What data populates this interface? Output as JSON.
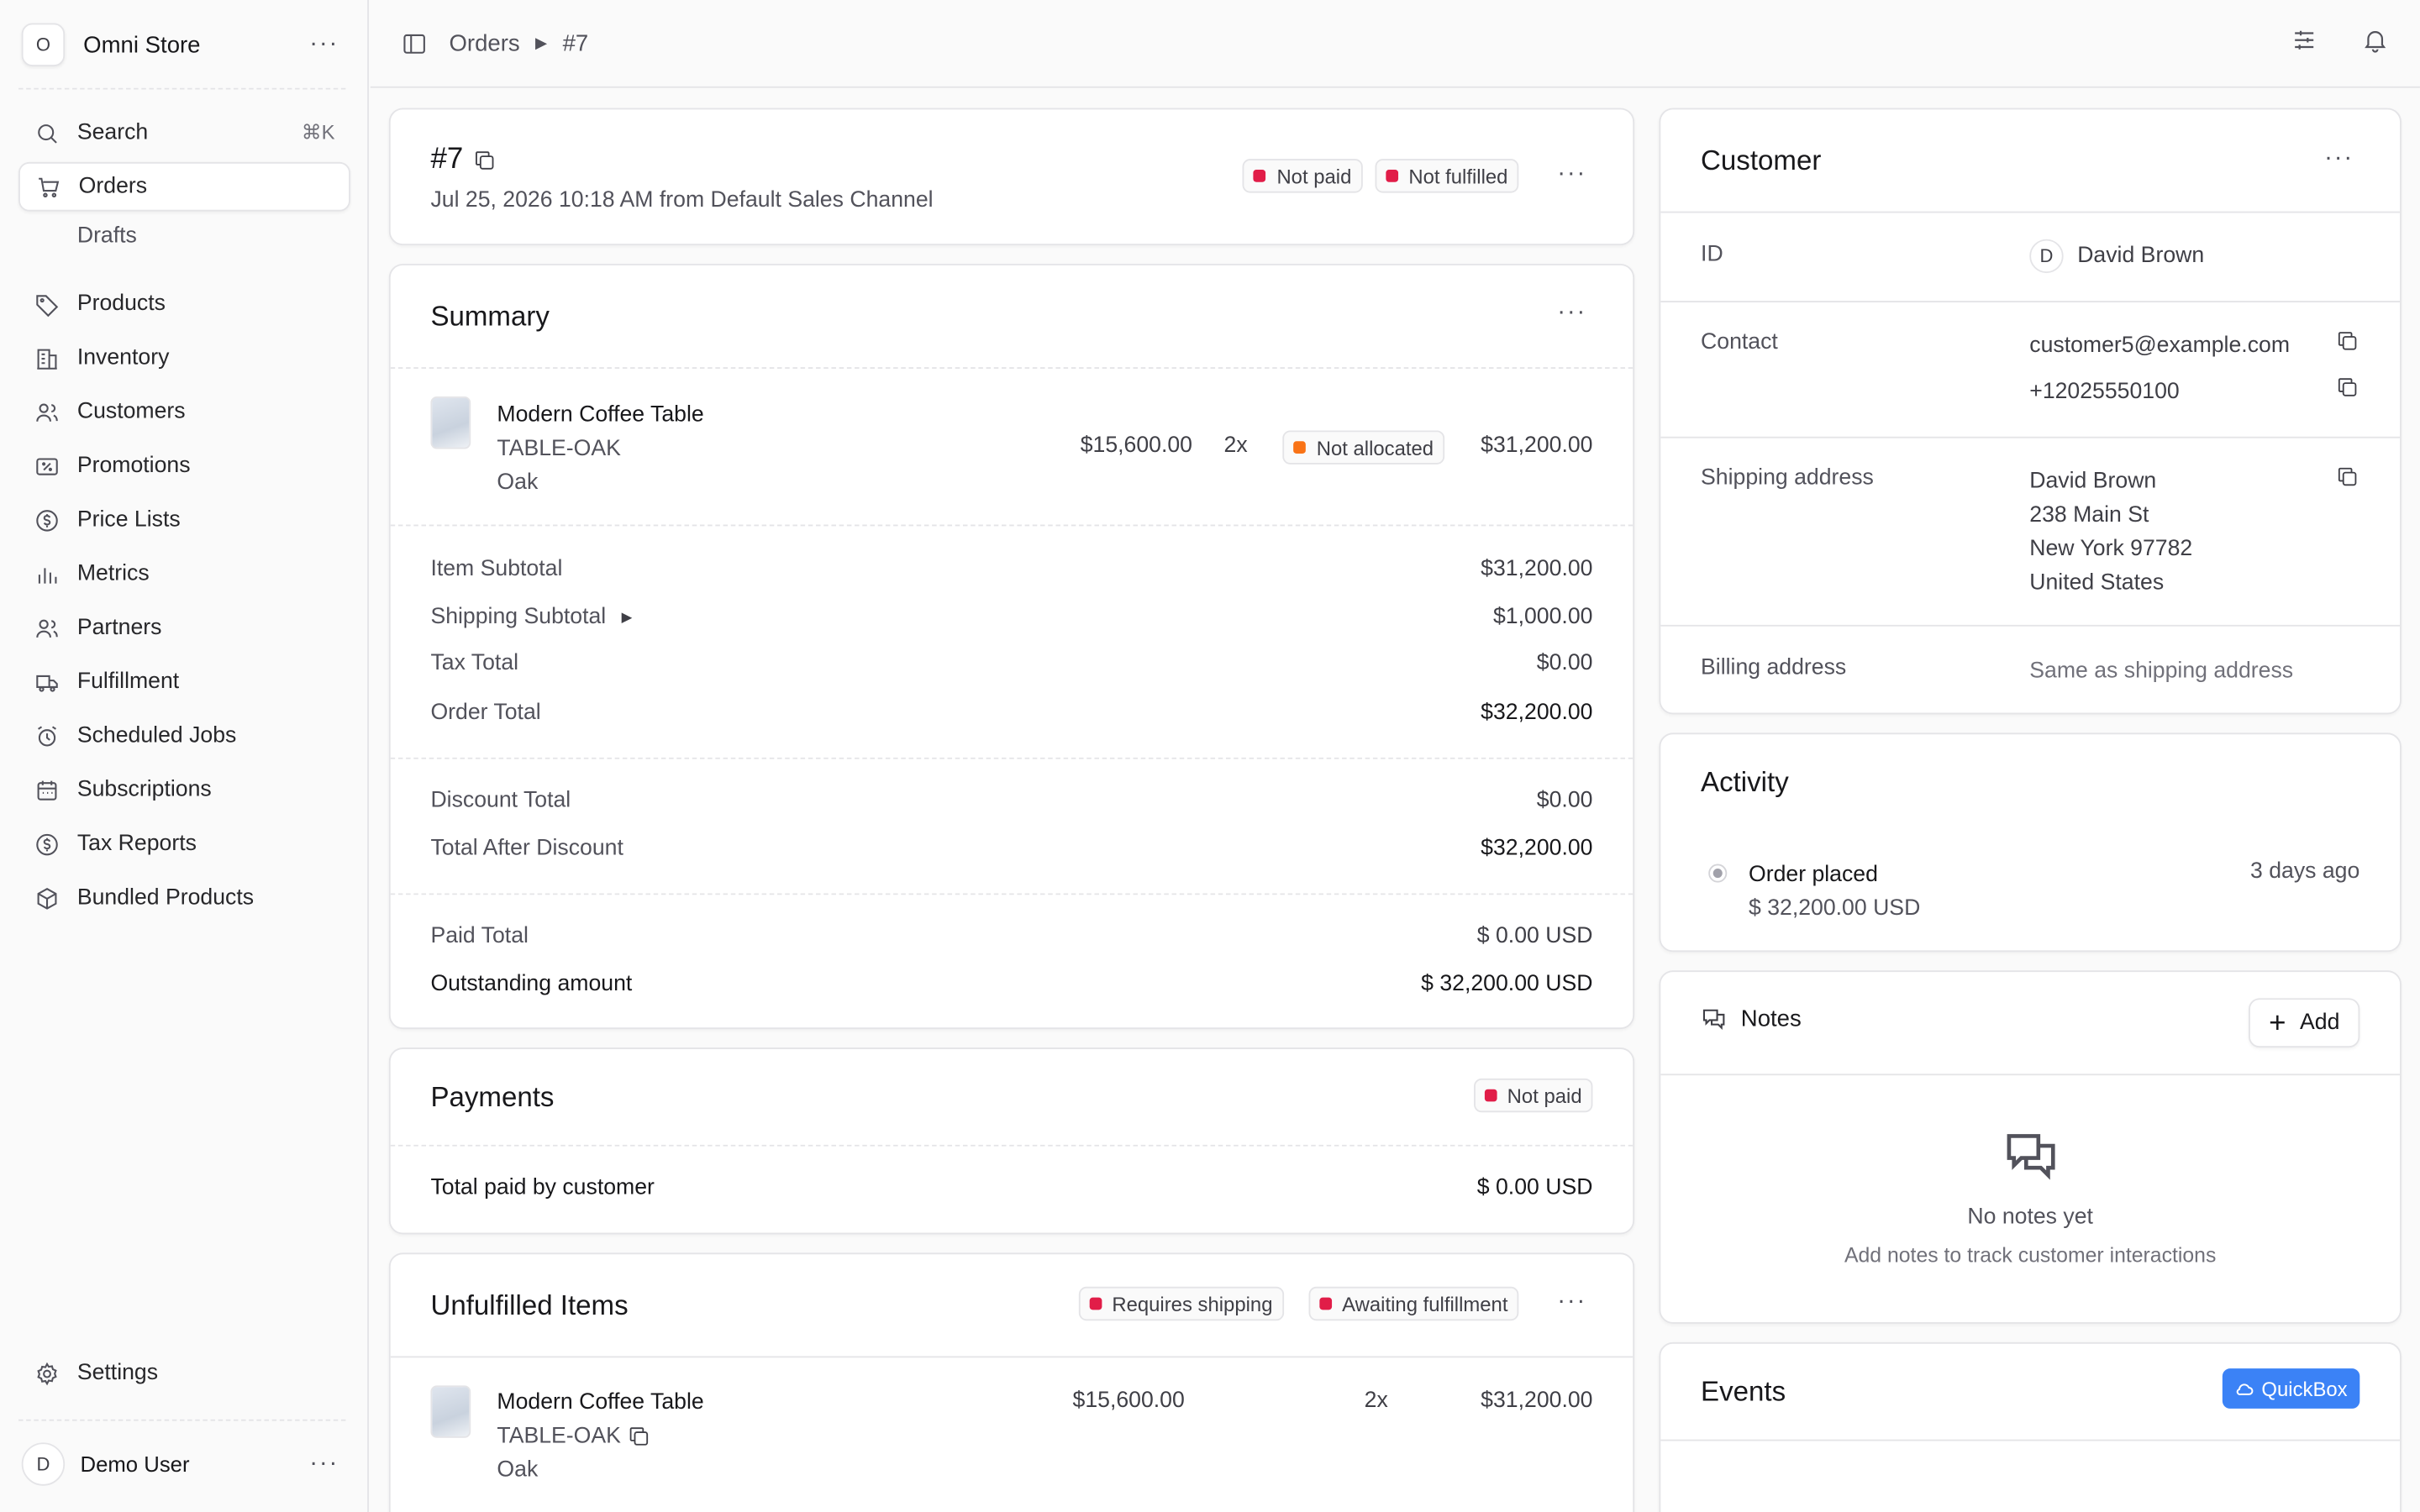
{
  "sidebar": {
    "store_initial": "O",
    "store_name": "Omni Store",
    "search_label": "Search",
    "search_kbd": "⌘K",
    "items": [
      {
        "label": "Orders"
      },
      {
        "label": "Drafts"
      },
      {
        "label": "Products"
      },
      {
        "label": "Inventory"
      },
      {
        "label": "Customers"
      },
      {
        "label": "Promotions"
      },
      {
        "label": "Price Lists"
      },
      {
        "label": "Metrics"
      },
      {
        "label": "Partners"
      },
      {
        "label": "Fulfillment"
      },
      {
        "label": "Scheduled Jobs"
      },
      {
        "label": "Subscriptions"
      },
      {
        "label": "Tax Reports"
      },
      {
        "label": "Bundled Products"
      }
    ],
    "settings_label": "Settings",
    "user_initial": "D",
    "user_name": "Demo User"
  },
  "breadcrumb": {
    "section": "Orders",
    "current": "#7"
  },
  "order": {
    "number": "#7",
    "subtitle": "Jul 25, 2026 10:18 AM from Default Sales Channel",
    "payment_status": "Not paid",
    "fulfillment_status": "Not fulfilled"
  },
  "summary": {
    "title": "Summary",
    "item": {
      "name": "Modern Coffee Table",
      "sku": "TABLE-OAK",
      "variant": "Oak",
      "unit_price": "$15,600.00",
      "qty": "2x",
      "allocation": "Not allocated",
      "total": "$31,200.00"
    },
    "rows": [
      {
        "label": "Item Subtotal",
        "value": "$31,200.00"
      },
      {
        "label": "Shipping Subtotal",
        "value": "$1,000.00"
      },
      {
        "label": "Tax Total",
        "value": "$0.00"
      },
      {
        "label": "Order Total",
        "value": "$32,200.00"
      },
      {
        "label": "Discount Total",
        "value": "$0.00"
      },
      {
        "label": "Total After Discount",
        "value": "$32,200.00"
      },
      {
        "label": "Paid Total",
        "value": "$ 0.00 USD"
      },
      {
        "label": "Outstanding amount",
        "value": "$ 32,200.00 USD"
      }
    ]
  },
  "payments": {
    "title": "Payments",
    "status": "Not paid",
    "total_label": "Total paid by customer",
    "total_value": "$ 0.00 USD"
  },
  "unfulfilled": {
    "title": "Unfulfilled Items",
    "badge1": "Requires shipping",
    "badge2": "Awaiting fulfillment",
    "item": {
      "name": "Modern Coffee Table",
      "sku": "TABLE-OAK",
      "variant": "Oak",
      "unit_price": "$15,600.00",
      "qty": "2x",
      "total": "$31,200.00"
    }
  },
  "customer": {
    "title": "Customer",
    "id_label": "ID",
    "initial": "D",
    "name": "David Brown",
    "contact_label": "Contact",
    "email": "customer5@example.com",
    "phone": "+12025550100",
    "shipping_label": "Shipping address",
    "shipping_lines": [
      "David Brown",
      "238 Main St",
      "New York 97782",
      "United States"
    ],
    "billing_label": "Billing address",
    "billing_value": "Same as shipping address"
  },
  "activity": {
    "title": "Activity",
    "event": "Order placed",
    "amount": "$ 32,200.00 USD",
    "time": "3 days ago"
  },
  "notes": {
    "title": "Notes",
    "add_label": "Add",
    "empty_title": "No notes yet",
    "empty_desc": "Add notes to track customer interactions"
  },
  "events": {
    "title": "Events",
    "quickbox_label": "QuickBox"
  },
  "colors": {
    "accent": "#3b82f6",
    "danger": "#e11d48",
    "warning": "#f97316"
  }
}
